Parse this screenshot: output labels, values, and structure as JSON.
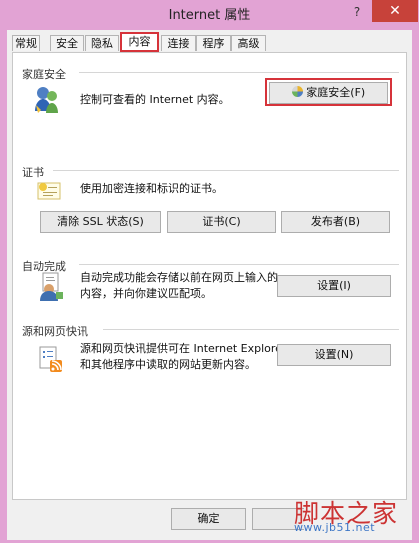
{
  "window": {
    "title": "Internet 属性",
    "help": "?",
    "close": "✕"
  },
  "tabs": [
    {
      "label": "常规"
    },
    {
      "label": "安全"
    },
    {
      "label": "隐私"
    },
    {
      "label": "内容",
      "selected": true
    },
    {
      "label": "连接"
    },
    {
      "label": "程序"
    },
    {
      "label": "高级"
    }
  ],
  "family_safety": {
    "title": "家庭安全",
    "description": "控制可查看的 Internet 内容。",
    "button": "家庭安全(F)"
  },
  "certificates": {
    "title": "证书",
    "description": "使用加密连接和标识的证书。",
    "buttons": [
      "清除 SSL 状态(S)",
      "证书(C)",
      "发布者(B)"
    ]
  },
  "autocomplete": {
    "title": "自动完成",
    "description_line1": "自动完成功能会存储以前在网页上输入的",
    "description_line2": "内容，并向你建议匹配项。",
    "button": "设置(I)"
  },
  "feeds": {
    "title": "源和网页快讯",
    "description_line1": "源和网页快讯提供可在 Internet Explorer",
    "description_line2": "和其他程序中读取的网站更新内容。",
    "button": "设置(N)"
  },
  "footer": {
    "ok": "确定"
  },
  "watermark": {
    "title": "脚本之家",
    "url": "www.jb51.net"
  },
  "colors": {
    "title_bar": "#e2a3d4",
    "highlight": "#d6333a",
    "close": "#c7423a"
  }
}
